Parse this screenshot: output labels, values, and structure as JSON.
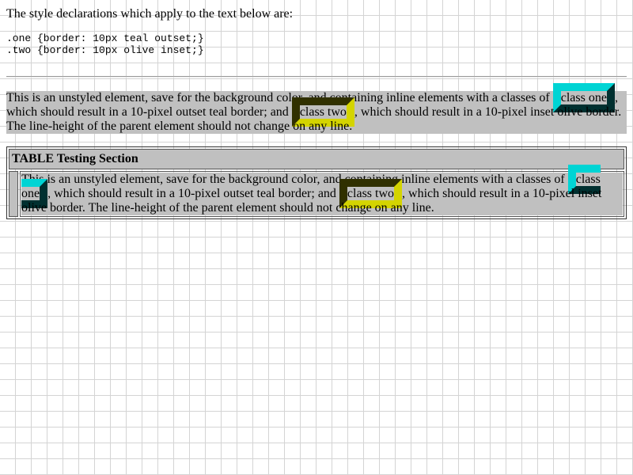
{
  "intro": "The style declarations which apply to the text below are:",
  "code": [
    ".one {border: 10px teal outset;}",
    ".two {border: 10px olive inset;}"
  ],
  "para": {
    "part1": "This is an unstyled element, save for the background color, and containing inline elements with a classes of ",
    "one": "class one",
    "part2": ", which should result in a 10-pixel outset teal border; and ",
    "two": "class two",
    "part3": ", which should result in a 10-pixel inset olive border. The line-height of the parent element should not change on any line."
  },
  "table": {
    "header": "TABLE Testing Section"
  },
  "colors": {
    "teal_light": "#00d4d4",
    "teal_dark": "#003030",
    "olive_light": "#d4d400",
    "olive_dark": "#303000",
    "test_bg": "#c0c0c0"
  }
}
